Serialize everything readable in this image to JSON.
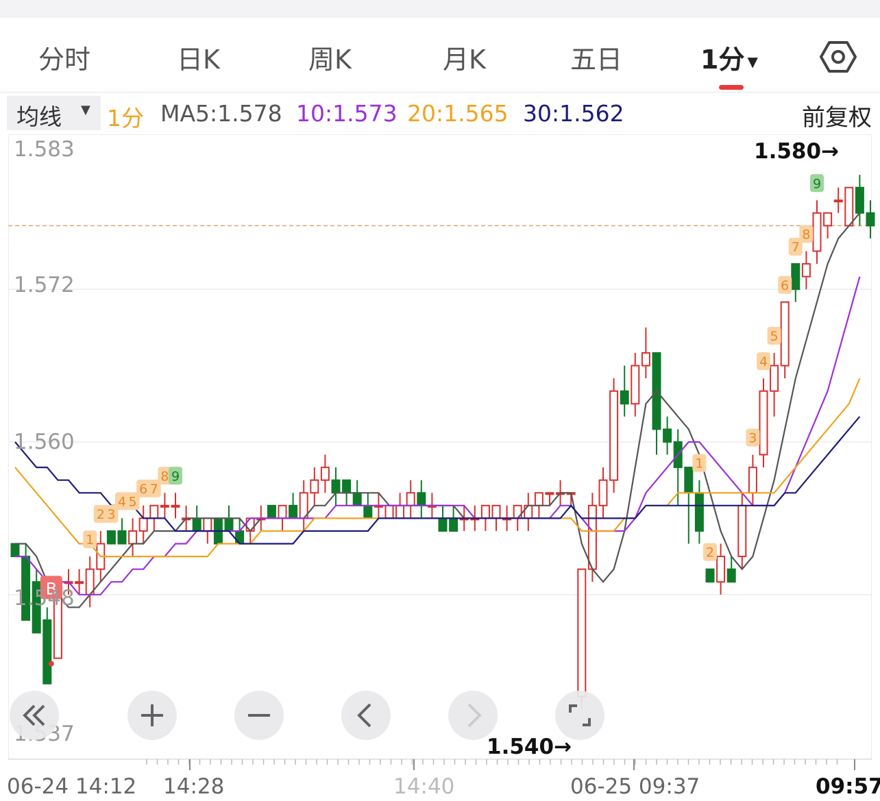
{
  "tabs": [
    {
      "label": "分时",
      "active": false
    },
    {
      "label": "日K",
      "active": false
    },
    {
      "label": "周K",
      "active": false
    },
    {
      "label": "月K",
      "active": false
    },
    {
      "label": "五日",
      "active": false
    },
    {
      "label": "1分",
      "active": true
    }
  ],
  "settings_icon": "gear-icon",
  "ma_bar": {
    "selector_label": "均线",
    "period": "1分",
    "ma5": "MA5:1.578",
    "ma10": "10:1.573",
    "ma20": "20:1.565",
    "ma30": "30:1.562",
    "restore": "前复权"
  },
  "colors": {
    "up": "#d7302f",
    "down": "#0f7a2a",
    "ma5": "#555555",
    "ma10": "#9b30d9",
    "ma20": "#f0a321",
    "ma30": "#1b1b7a",
    "ref": "#e8a070",
    "accent": "#e83a3a"
  },
  "chart_data": {
    "type": "candlestick",
    "y_ticks": [
      "1.583",
      "1.572",
      "1.560",
      "1.548",
      "1.537"
    ],
    "ylim": [
      1.537,
      1.583
    ],
    "high_marker": "1.580→",
    "low_marker": "1.540→",
    "reference_price": 1.577,
    "buy_marker": "B",
    "x_labels": [
      "06-24 14:12",
      "14:28",
      "14:40",
      "06-25 09:37",
      "09:57"
    ],
    "candles": [
      [
        1.552,
        1.552,
        1.552,
        1.551
      ],
      [
        1.551,
        1.552,
        1.549,
        1.546
      ],
      [
        1.549,
        1.55,
        1.546,
        1.545
      ],
      [
        1.546,
        1.547,
        1.543,
        1.541
      ],
      [
        1.543,
        1.549,
        1.543,
        1.549
      ],
      [
        1.549,
        1.55,
        1.548,
        1.549
      ],
      [
        1.549,
        1.55,
        1.548,
        1.549
      ],
      [
        1.548,
        1.551,
        1.547,
        1.55
      ],
      [
        1.55,
        1.553,
        1.549,
        1.552
      ],
      [
        1.553,
        1.553,
        1.553,
        1.552
      ],
      [
        1.553,
        1.554,
        1.552,
        1.552
      ],
      [
        1.552,
        1.554,
        1.551,
        1.553
      ],
      [
        1.553,
        1.555,
        1.552,
        1.554
      ],
      [
        1.554,
        1.555,
        1.553,
        1.555
      ],
      [
        1.555,
        1.556,
        1.554,
        1.555
      ],
      [
        1.555,
        1.556,
        1.554,
        1.555
      ],
      [
        1.554,
        1.555,
        1.553,
        1.554
      ],
      [
        1.554,
        1.555,
        1.553,
        1.553
      ],
      [
        1.553,
        1.554,
        1.552,
        1.554
      ],
      [
        1.554,
        1.554,
        1.553,
        1.552
      ],
      [
        1.554,
        1.555,
        1.553,
        1.553
      ],
      [
        1.553,
        1.554,
        1.552,
        1.552
      ],
      [
        1.553,
        1.554,
        1.552,
        1.554
      ],
      [
        1.554,
        1.555,
        1.553,
        1.554
      ],
      [
        1.555,
        1.555,
        1.554,
        1.554
      ],
      [
        1.554,
        1.555,
        1.553,
        1.555
      ],
      [
        1.555,
        1.556,
        1.554,
        1.554
      ],
      [
        1.554,
        1.557,
        1.553,
        1.556
      ],
      [
        1.556,
        1.558,
        1.555,
        1.557
      ],
      [
        1.557,
        1.559,
        1.556,
        1.558
      ],
      [
        1.557,
        1.558,
        1.555,
        1.556
      ],
      [
        1.557,
        1.557,
        1.555,
        1.556
      ],
      [
        1.556,
        1.557,
        1.555,
        1.555
      ],
      [
        1.555,
        1.556,
        1.554,
        1.554
      ],
      [
        1.555,
        1.556,
        1.554,
        1.555
      ],
      [
        1.554,
        1.555,
        1.554,
        1.555
      ],
      [
        1.554,
        1.556,
        1.554,
        1.555
      ],
      [
        1.555,
        1.557,
        1.554,
        1.556
      ],
      [
        1.556,
        1.557,
        1.554,
        1.555
      ],
      [
        1.555,
        1.556,
        1.554,
        1.555
      ],
      [
        1.554,
        1.555,
        1.553,
        1.553
      ],
      [
        1.554,
        1.555,
        1.553,
        1.553
      ],
      [
        1.554,
        1.555,
        1.553,
        1.554
      ],
      [
        1.554,
        1.555,
        1.553,
        1.554
      ],
      [
        1.554,
        1.555,
        1.553,
        1.555
      ],
      [
        1.554,
        1.555,
        1.553,
        1.555
      ],
      [
        1.554,
        1.555,
        1.553,
        1.554
      ],
      [
        1.554,
        1.555,
        1.553,
        1.555
      ],
      [
        1.554,
        1.556,
        1.553,
        1.555
      ],
      [
        1.555,
        1.556,
        1.554,
        1.556
      ],
      [
        1.556,
        1.556,
        1.555,
        1.556
      ],
      [
        1.556,
        1.557,
        1.555,
        1.556
      ],
      [
        1.556,
        1.556,
        1.555,
        1.556
      ],
      [
        1.54,
        1.55,
        1.539,
        1.55
      ],
      [
        1.55,
        1.556,
        1.549,
        1.555
      ],
      [
        1.555,
        1.558,
        1.554,
        1.557
      ],
      [
        1.557,
        1.565,
        1.556,
        1.564
      ],
      [
        1.564,
        1.566,
        1.562,
        1.563
      ],
      [
        1.563,
        1.567,
        1.562,
        1.566
      ],
      [
        1.566,
        1.569,
        1.565,
        1.567
      ],
      [
        1.567,
        1.567,
        1.559,
        1.561
      ],
      [
        1.561,
        1.562,
        1.559,
        1.56
      ],
      [
        1.56,
        1.561,
        1.555,
        1.558
      ],
      [
        1.558,
        1.558,
        1.552,
        1.556
      ],
      [
        1.556,
        1.557,
        1.552,
        1.553
      ],
      [
        1.55,
        1.55,
        1.549,
        1.549
      ],
      [
        1.549,
        1.552,
        1.548,
        1.551
      ],
      [
        1.55,
        1.551,
        1.549,
        1.549
      ],
      [
        1.551,
        1.556,
        1.55,
        1.555
      ],
      [
        1.556,
        1.559,
        1.555,
        1.558
      ],
      [
        1.559,
        1.565,
        1.558,
        1.564
      ],
      [
        1.564,
        1.567,
        1.562,
        1.566
      ],
      [
        1.566,
        1.571,
        1.565,
        1.571
      ],
      [
        1.574,
        1.574,
        1.571,
        1.572
      ],
      [
        1.573,
        1.575,
        1.572,
        1.574
      ],
      [
        1.575,
        1.579,
        1.574,
        1.578
      ],
      [
        1.577,
        1.578,
        1.576,
        1.578
      ],
      [
        1.579,
        1.58,
        1.578,
        1.579
      ],
      [
        1.577,
        1.58,
        1.577,
        1.58
      ],
      [
        1.58,
        1.581,
        1.577,
        1.578
      ],
      [
        1.578,
        1.579,
        1.576,
        1.577
      ]
    ],
    "series": [
      {
        "name": "MA5",
        "values": [
          1.552,
          1.552,
          1.551,
          1.549,
          1.548,
          1.547,
          1.547,
          1.548,
          1.549,
          1.55,
          1.551,
          1.552,
          1.552,
          1.553,
          1.553,
          1.553,
          1.554,
          1.554,
          1.554,
          1.554,
          1.554,
          1.554,
          1.553,
          1.554,
          1.554,
          1.554,
          1.554,
          1.554,
          1.555,
          1.555,
          1.556,
          1.556,
          1.556,
          1.556,
          1.556,
          1.555,
          1.555,
          1.555,
          1.555,
          1.555,
          1.555,
          1.555,
          1.554,
          1.554,
          1.554,
          1.554,
          1.554,
          1.554,
          1.555,
          1.555,
          1.555,
          1.556,
          1.556,
          1.552,
          1.55,
          1.549,
          1.55,
          1.553,
          1.558,
          1.563,
          1.564,
          1.563,
          1.562,
          1.561,
          1.559,
          1.556,
          1.553,
          1.551,
          1.55,
          1.551,
          1.554,
          1.557,
          1.561,
          1.565,
          1.568,
          1.571,
          1.574,
          1.576,
          1.577,
          1.578
        ]
      },
      {
        "name": "MA10",
        "values": [
          1.551,
          1.551,
          1.55,
          1.549,
          1.549,
          1.549,
          1.548,
          1.548,
          1.548,
          1.549,
          1.549,
          1.55,
          1.55,
          1.551,
          1.551,
          1.552,
          1.552,
          1.553,
          1.553,
          1.553,
          1.553,
          1.553,
          1.554,
          1.554,
          1.554,
          1.554,
          1.554,
          1.554,
          1.554,
          1.554,
          1.555,
          1.555,
          1.555,
          1.555,
          1.555,
          1.555,
          1.555,
          1.555,
          1.555,
          1.555,
          1.555,
          1.555,
          1.555,
          1.554,
          1.554,
          1.554,
          1.554,
          1.554,
          1.554,
          1.554,
          1.554,
          1.555,
          1.555,
          1.554,
          1.553,
          1.553,
          1.553,
          1.553,
          1.554,
          1.556,
          1.557,
          1.558,
          1.559,
          1.56,
          1.56,
          1.559,
          1.558,
          1.557,
          1.556,
          1.555,
          1.555,
          1.555,
          1.556,
          1.558,
          1.56,
          1.562,
          1.564,
          1.567,
          1.57,
          1.573
        ]
      },
      {
        "name": "MA20",
        "values": [
          1.558,
          1.557,
          1.556,
          1.555,
          1.554,
          1.553,
          1.552,
          1.552,
          1.551,
          1.551,
          1.551,
          1.551,
          1.551,
          1.551,
          1.551,
          1.551,
          1.551,
          1.551,
          1.551,
          1.552,
          1.552,
          1.552,
          1.552,
          1.553,
          1.553,
          1.553,
          1.553,
          1.553,
          1.554,
          1.554,
          1.554,
          1.554,
          1.554,
          1.554,
          1.554,
          1.554,
          1.554,
          1.554,
          1.554,
          1.554,
          1.554,
          1.554,
          1.554,
          1.554,
          1.554,
          1.554,
          1.554,
          1.554,
          1.554,
          1.554,
          1.554,
          1.554,
          1.554,
          1.553,
          1.553,
          1.553,
          1.553,
          1.554,
          1.554,
          1.555,
          1.555,
          1.555,
          1.556,
          1.556,
          1.556,
          1.556,
          1.556,
          1.556,
          1.556,
          1.556,
          1.556,
          1.556,
          1.557,
          1.558,
          1.559,
          1.56,
          1.561,
          1.562,
          1.563,
          1.565
        ]
      },
      {
        "name": "MA30",
        "values": [
          1.56,
          1.559,
          1.558,
          1.558,
          1.557,
          1.557,
          1.556,
          1.556,
          1.556,
          1.555,
          1.555,
          1.555,
          1.554,
          1.554,
          1.554,
          1.553,
          1.553,
          1.553,
          1.553,
          1.553,
          1.553,
          1.552,
          1.552,
          1.552,
          1.552,
          1.552,
          1.552,
          1.553,
          1.553,
          1.553,
          1.553,
          1.553,
          1.553,
          1.553,
          1.554,
          1.554,
          1.554,
          1.554,
          1.554,
          1.554,
          1.554,
          1.554,
          1.554,
          1.554,
          1.554,
          1.554,
          1.554,
          1.554,
          1.554,
          1.554,
          1.554,
          1.554,
          1.555,
          1.554,
          1.554,
          1.554,
          1.554,
          1.554,
          1.554,
          1.555,
          1.555,
          1.555,
          1.555,
          1.555,
          1.555,
          1.555,
          1.555,
          1.555,
          1.555,
          1.555,
          1.555,
          1.555,
          1.556,
          1.556,
          1.557,
          1.558,
          1.559,
          1.56,
          1.561,
          1.562
        ]
      }
    ],
    "signals": [
      {
        "i": 7,
        "label": "1",
        "kind": "setup"
      },
      {
        "i": 8,
        "label": "2",
        "kind": "setup"
      },
      {
        "i": 9,
        "label": "3",
        "kind": "setup"
      },
      {
        "i": 10,
        "label": "4",
        "kind": "setup"
      },
      {
        "i": 11,
        "label": "5",
        "kind": "setup"
      },
      {
        "i": 12,
        "label": "6",
        "kind": "setup"
      },
      {
        "i": 13,
        "label": "7",
        "kind": "setup"
      },
      {
        "i": 14,
        "label": "8",
        "kind": "setup"
      },
      {
        "i": 15,
        "label": "9",
        "kind": "done"
      },
      {
        "i": 64,
        "label": "1",
        "kind": "setup"
      },
      {
        "i": 65,
        "label": "2",
        "kind": "setup"
      },
      {
        "i": 69,
        "label": "3",
        "kind": "setup"
      },
      {
        "i": 70,
        "label": "4",
        "kind": "setup"
      },
      {
        "i": 71,
        "label": "5",
        "kind": "setup"
      },
      {
        "i": 72,
        "label": "6",
        "kind": "setup"
      },
      {
        "i": 73,
        "label": "7",
        "kind": "setup"
      },
      {
        "i": 74,
        "label": "8",
        "kind": "setup"
      },
      {
        "i": 75,
        "label": "9",
        "kind": "done"
      }
    ]
  },
  "controls": [
    {
      "name": "scroll-left-far-button",
      "icon": "double-chevron-left-icon"
    },
    {
      "name": "zoom-in-button",
      "icon": "plus-icon"
    },
    {
      "name": "zoom-out-button",
      "icon": "minus-icon"
    },
    {
      "name": "scroll-left-button",
      "icon": "chevron-left-icon"
    },
    {
      "name": "scroll-right-button",
      "icon": "chevron-right-icon"
    },
    {
      "name": "fullscreen-button",
      "icon": "fullscreen-icon"
    }
  ]
}
